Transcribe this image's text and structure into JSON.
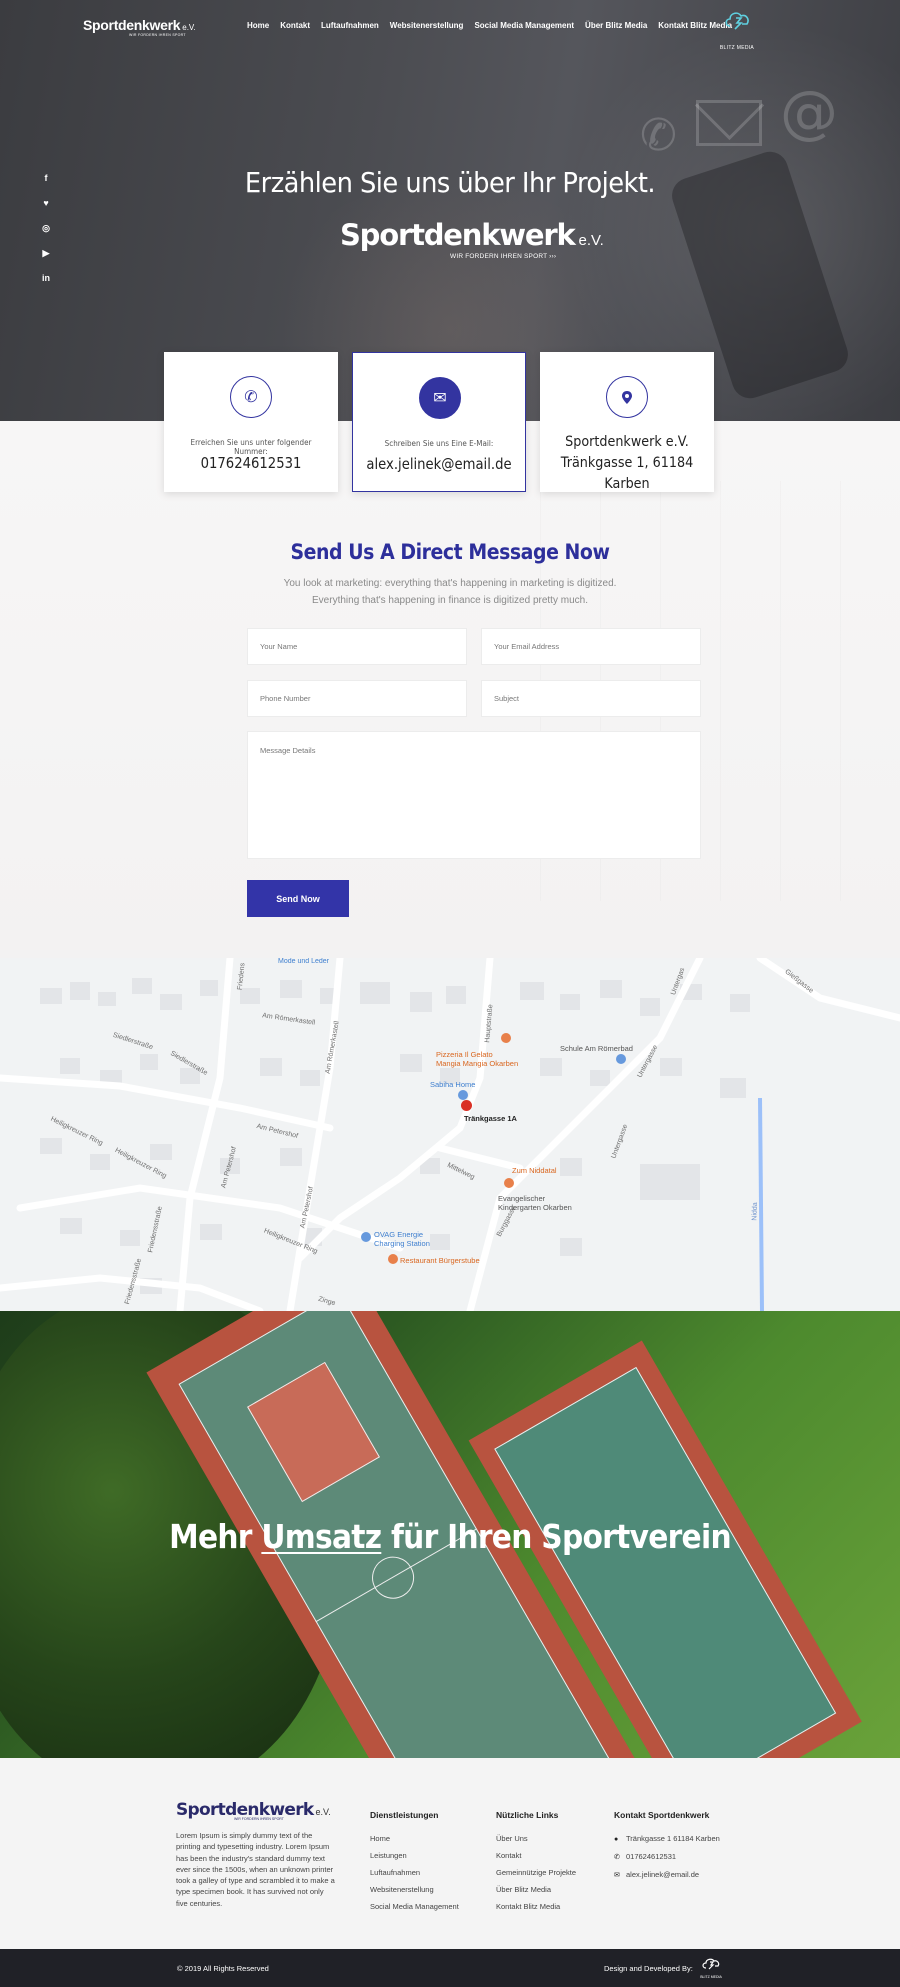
{
  "header": {
    "logo": {
      "brand": "Sportdenkwerk",
      "ev": "e.V.",
      "tagline": "WIR FORDERN IHREN SPORT"
    },
    "nav": [
      "Home",
      "Kontakt",
      "Luftaufnahmen",
      "Websitenerstellung",
      "Social Media Management",
      "Über Blitz Media",
      "Kontakt Blitz Media"
    ],
    "partner_logo": {
      "icon": "cloud-bolt-icon",
      "label": "BLITZ MEDIA"
    }
  },
  "social": [
    "facebook-icon",
    "twitter-icon",
    "instagram-icon",
    "youtube-icon",
    "linkedin-icon"
  ],
  "hero": {
    "title": "Erzählen Sie uns über Ihr Projekt.",
    "logo_brand": "Sportdenkwerk",
    "logo_ev": "e.V.",
    "logo_tagline": "WIR FORDERN IHREN SPORT ›››"
  },
  "cards": [
    {
      "icon": "phone-icon",
      "caption": "Erreichen Sie uns unter folgender Nummer:",
      "value": "017624612531"
    },
    {
      "icon": "mail-icon",
      "caption": "Schreiben Sie uns Eine E-Mail:",
      "value": "alex.jelinek@email.de"
    },
    {
      "icon": "location-pin-icon",
      "line1": "Sportdenkwerk e.V.",
      "line2": "Tränkgasse 1, 61184 Karben"
    }
  ],
  "form": {
    "title": "Send Us A Direct Message Now",
    "subtitle_1": "You look at marketing: everything that's happening in marketing is digitized.",
    "subtitle_2": "Everything that's happening in finance is digitized pretty much.",
    "name_placeholder": "Your Name",
    "email_placeholder": "Your Email Address",
    "phone_placeholder": "Phone Number",
    "subject_placeholder": "Subject",
    "message_placeholder": "Message Details",
    "submit_label": "Send Now"
  },
  "map": {
    "labels": [
      "Mode und Leder",
      "Am Römerkastell",
      "Friedens",
      "Siedlerstraße",
      "Siedlerstraße",
      "Hauptstraße",
      "Untergas",
      "Gießgasse",
      "Am Römerkastell",
      "Am Petershof",
      "Heiligkreuzer Ring",
      "Heiligkreuzer Ring",
      "Heiligkreuzer Ring",
      "Friedensstraße",
      "Friedensstraße",
      "Am Petershof",
      "Am Petershof",
      "Mittelweg",
      "Untergasse",
      "Untergasse",
      "Burggasse",
      "Nidda",
      "Zinge"
    ],
    "pois": {
      "pizzeria": "Pizzeria Il Gelato\nMangia Mangia Okarben",
      "school": "Schule Am Römerbad",
      "sabiha": "Sabiha Home",
      "target": "Tränkgasse 1A",
      "zum": "Zum Niddatal",
      "kita": "Evangelischer\nKindergarten Okarben",
      "ovag": "OVAG Energie\nCharging Station",
      "restaurant": "Restaurant Bürgerstube"
    }
  },
  "banner": {
    "title_pre": "Mehr",
    "title_underlined": "Umsatz",
    "title_post": "für Ihren Sportverein"
  },
  "footer": {
    "logo_brand": "Sportdenkwerk",
    "logo_ev": "e.V.",
    "logo_tagline": "WIR FORDERN IHREN SPORT",
    "about": "Lorem Ipsum is simply dummy text of the printing and typesetting industry. Lorem Ipsum has been the industry's standard dummy text ever since the 1500s, when an unknown printer took a galley of type and scrambled it to make a type specimen book. It has survived not only five centuries.",
    "services_title": "Dienstleistungen",
    "services": [
      "Home",
      "Leistungen",
      "Luftaufnahmen",
      "Websitenerstellung",
      "Social Media Management"
    ],
    "links_title": "Nützliche Links",
    "links": [
      "Über Uns",
      "Kontakt",
      "Gemeinnützige Projekte",
      "Über Blitz Media",
      "Kontakt Blitz Media"
    ],
    "contact_title": "Kontakt Sportdenkwerk",
    "contact_address": "Tränkgasse 1 61184 Karben",
    "contact_phone": "017624612531",
    "contact_email": "alex.jelinek@email.de",
    "copyright": "© 2019 All Rights Reserved",
    "developed_by": "Design and Developed By:",
    "developer_logo": "BLITZ MEDIA"
  }
}
